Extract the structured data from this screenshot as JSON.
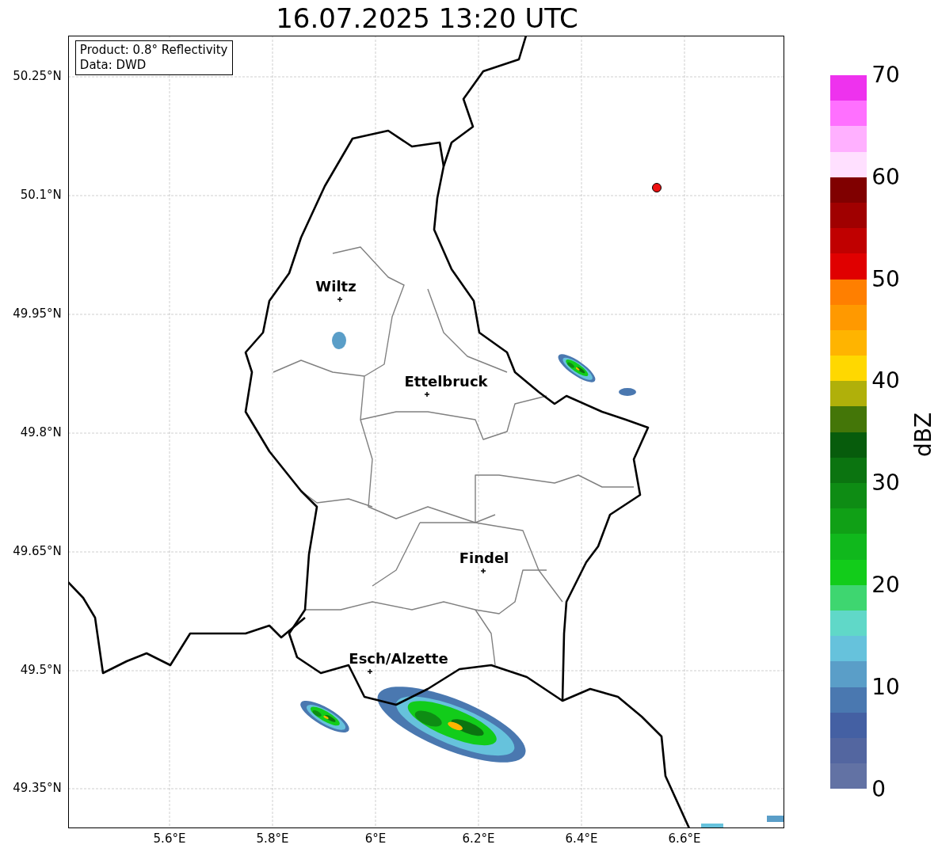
{
  "title": "16.07.2025 13:20 UTC",
  "info_box": [
    "Product: 0.8° Reflectivity",
    "Data: DWD"
  ],
  "cities": [
    {
      "name": "Wiltz"
    },
    {
      "name": "Ettelbruck"
    },
    {
      "name": "Findel"
    },
    {
      "name": "Esch/Alzette"
    }
  ],
  "y_ticks": [
    "50.25°N",
    "50.1°N",
    "49.95°N",
    "49.8°N",
    "49.65°N",
    "49.5°N",
    "49.35°N"
  ],
  "x_ticks": [
    "5.6°E",
    "5.8°E",
    "6°E",
    "6.2°E",
    "6.4°E",
    "6.6°E"
  ],
  "colorbar": {
    "label": "dBZ",
    "ticks": [
      "70",
      "60",
      "50",
      "40",
      "30",
      "20",
      "10",
      "0"
    ],
    "bins": [
      {
        "color": "#ee32ee"
      },
      {
        "color": "#ff70ff"
      },
      {
        "color": "#ffb0ff"
      },
      {
        "color": "#ffe0ff"
      },
      {
        "color": "#800000"
      },
      {
        "color": "#a00000"
      },
      {
        "color": "#c00000"
      },
      {
        "color": "#e00000"
      },
      {
        "color": "#ff7f00"
      },
      {
        "color": "#ff9900"
      },
      {
        "color": "#ffb400"
      },
      {
        "color": "#ffd800"
      },
      {
        "color": "#b0b00a"
      },
      {
        "color": "#447608"
      },
      {
        "color": "#075c0c"
      },
      {
        "color": "#0b7410"
      },
      {
        "color": "#0e8c14"
      },
      {
        "color": "#10a016"
      },
      {
        "color": "#10b81c"
      },
      {
        "color": "#12cc1a"
      },
      {
        "color": "#3ed670"
      },
      {
        "color": "#60d8c8"
      },
      {
        "color": "#66c2dc"
      },
      {
        "color": "#5a9ec8"
      },
      {
        "color": "#4a78b0"
      },
      {
        "color": "#4460a3"
      },
      {
        "color": "#5366a0"
      },
      {
        "color": "#6272a4"
      }
    ]
  }
}
